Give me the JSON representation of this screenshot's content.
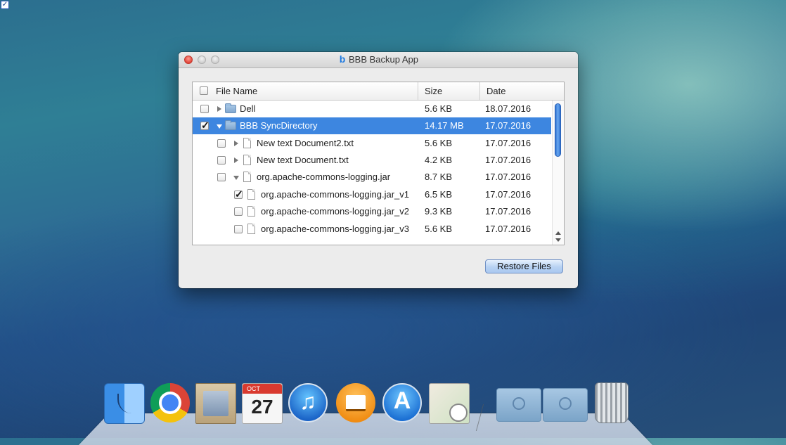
{
  "window": {
    "title": "BBB Backup App",
    "logo_glyph": "b"
  },
  "table": {
    "columns": {
      "name": "File Name",
      "size": "Size",
      "date": "Date"
    },
    "rows": [
      {
        "name": "Dell",
        "size": "5.6 KB",
        "date": "18.07.2016"
      },
      {
        "name": "BBB SyncDirectory",
        "size": "14.17 MB",
        "date": "17.07.2016"
      },
      {
        "name": "New text Document2.txt",
        "size": "5.6 KB",
        "date": "17.07.2016"
      },
      {
        "name": "New text Document.txt",
        "size": "4.2 KB",
        "date": "17.07.2016"
      },
      {
        "name": "org.apache-commons-logging.jar",
        "size": "8.7 KB",
        "date": "17.07.2016"
      },
      {
        "name": "org.apache-commons-logging.jar_v1",
        "size": "6.5 KB",
        "date": "17.07.2016"
      },
      {
        "name": "org.apache-commons-logging.jar_v2",
        "size": "9.3 KB",
        "date": "17.07.2016"
      },
      {
        "name": "org.apache-commons-logging.jar_v3",
        "size": "5.6 KB",
        "date": "17.07.2016"
      }
    ]
  },
  "buttons": {
    "restore": "Restore Files"
  },
  "dock": {
    "calendar_month": "OCT",
    "calendar_day": "27"
  },
  "colors": {
    "selection": "#3d86e0",
    "accent": "#1f7ae0"
  }
}
